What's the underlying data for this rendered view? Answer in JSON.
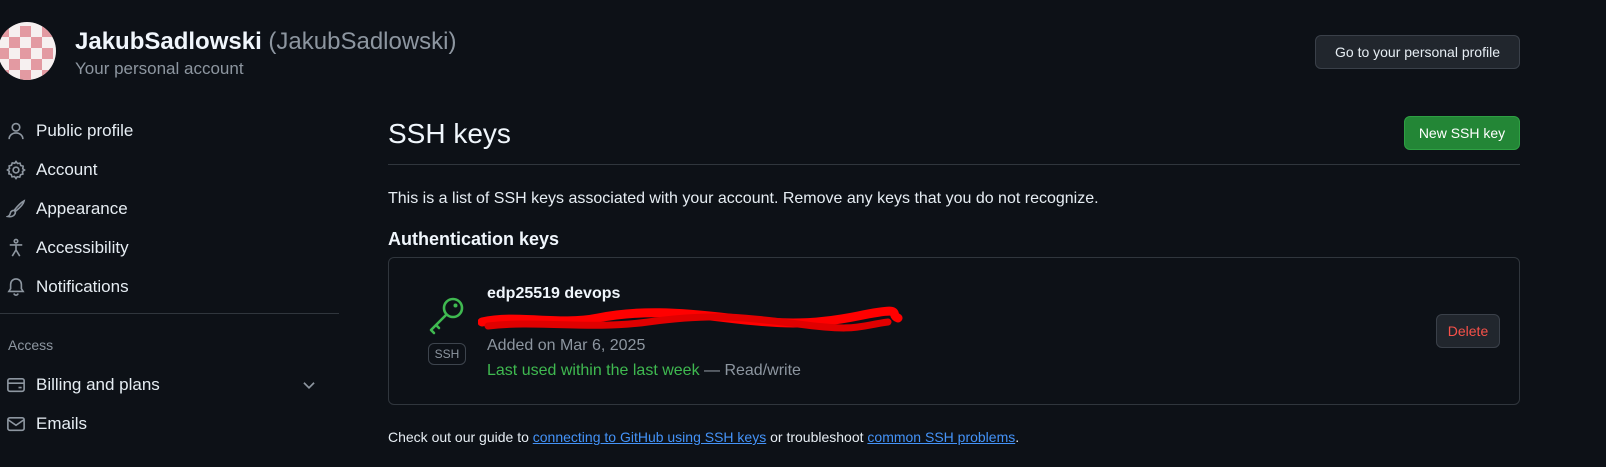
{
  "header": {
    "account_name": "JakubSadlowski",
    "account_handle": "(JakubSadlowski)",
    "account_subtitle": "Your personal account",
    "profile_button": "Go to your personal profile"
  },
  "sidebar": {
    "items": [
      {
        "label": "Public profile",
        "icon": "person-icon"
      },
      {
        "label": "Account",
        "icon": "gear-icon"
      },
      {
        "label": "Appearance",
        "icon": "paintbrush-icon"
      },
      {
        "label": "Accessibility",
        "icon": "accessibility-icon"
      },
      {
        "label": "Notifications",
        "icon": "bell-icon"
      }
    ],
    "access_section": {
      "heading": "Access",
      "items": [
        {
          "label": "Billing and plans",
          "icon": "credit-card-icon",
          "expandable": true
        },
        {
          "label": "Emails",
          "icon": "mail-icon"
        }
      ]
    }
  },
  "main": {
    "title": "SSH keys",
    "new_key_button": "New SSH key",
    "description": "This is a list of SSH keys associated with your account. Remove any keys that you do not recognize.",
    "auth_heading": "Authentication keys",
    "keys": [
      {
        "title": "edp25519 devops",
        "type_badge": "SSH",
        "added": "Added on Mar 6, 2025",
        "last_used": "Last used within the last week",
        "access": " — Read/write",
        "delete_label": "Delete"
      }
    ],
    "footer": {
      "prefix": "Check out our guide to ",
      "link1": "connecting to GitHub using SSH keys",
      "middle": " or troubleshoot ",
      "link2": "common SSH problems",
      "suffix": "."
    }
  },
  "colors": {
    "background": "#0d1117",
    "primary_button": "#238636",
    "danger_text": "#f85149",
    "success_text": "#3fb950",
    "link": "#4493f8"
  }
}
